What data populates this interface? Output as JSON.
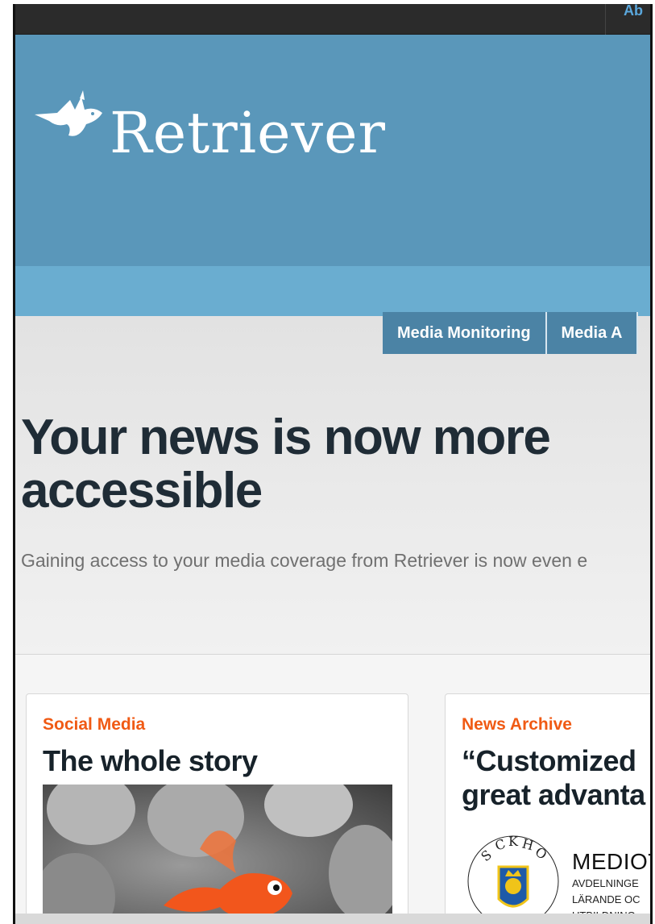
{
  "topbar": {
    "link_label": "Ab"
  },
  "brand": {
    "name": "Retriever"
  },
  "nav": {
    "items": [
      {
        "label": "Media Monitoring"
      },
      {
        "label": "Media A"
      }
    ]
  },
  "main": {
    "headline": "Your news is now more accessible",
    "lead": "Gaining access to your media coverage from Retriever is now even e"
  },
  "cards": [
    {
      "category": "Social Media",
      "title": "The whole story"
    },
    {
      "category": "News Archive",
      "title_line1": "“Customized",
      "title_line2": "great advanta",
      "org_name": "MEDIOT",
      "org_lines": [
        "AVDELNINGE",
        "LÄRANDE OC",
        "UTBILDNING"
      ]
    }
  ],
  "colors": {
    "hero": "#5a97ba",
    "nav": "#4b83a5",
    "accent": "#f05a14",
    "headline": "#1f2c36"
  },
  "icons": {
    "logo": "fish-logo-icon",
    "emblem": "stockholm-emblem-icon",
    "image": "goldfish-photo"
  }
}
